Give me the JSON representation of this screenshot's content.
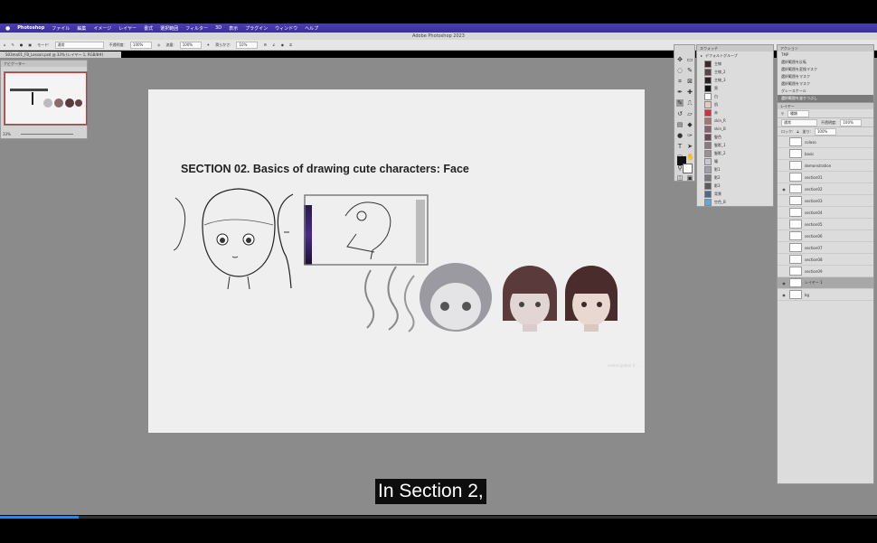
{
  "menubar": {
    "app": "Photoshop",
    "items": [
      "ファイル",
      "編集",
      "イメージ",
      "レイヤー",
      "書式",
      "選択範囲",
      "フィルター",
      "3D",
      "表示",
      "プラグイン",
      "ウィンドウ",
      "ヘルプ"
    ]
  },
  "window": {
    "title": "Adobe Photoshop 2023",
    "document_tab": "S03ma01_FB_Lesson.psd @ 33% (レイヤー 1, RGB/8#)"
  },
  "options_bar": {
    "mode_label": "モード:",
    "mode_value": "通常",
    "opacity_label": "不透明度:",
    "opacity_value": "100%",
    "flow_label": "流量:",
    "flow_value": "100%",
    "smoothing_label": "滑らかさ:",
    "smoothing_value": "10%"
  },
  "navigator": {
    "title": "ナビゲーター",
    "zoom": "33%"
  },
  "canvas": {
    "heading": "SECTION 02.  Basics of drawing cute characters: Face",
    "watermark": "coloso.global © ..."
  },
  "swatches": {
    "title": "スウォッチ",
    "group": "デフォルトグループ",
    "items": [
      {
        "name": "主線",
        "color": "#3a2a28"
      },
      {
        "name": "主線_2",
        "color": "#5a4642"
      },
      {
        "name": "主線_3",
        "color": "#2a2222"
      },
      {
        "name": "黒",
        "color": "#111111"
      },
      {
        "name": "白",
        "color": "#ffffff"
      },
      {
        "name": "肌",
        "color": "#e8c9b8"
      },
      {
        "name": "赤",
        "color": "#d03040"
      },
      {
        "name": "skin_R",
        "color": "#b07070"
      },
      {
        "name": "skin_B",
        "color": "#8a6070"
      },
      {
        "name": "髪色",
        "color": "#6a4a50"
      },
      {
        "name": "髪影_1",
        "color": "#8a7a80"
      },
      {
        "name": "髪影_2",
        "color": "#9a9098"
      },
      {
        "name": "瞳",
        "color": "#c8c8d0"
      },
      {
        "name": "影1",
        "color": "#a0a0a8"
      },
      {
        "name": "影2",
        "color": "#7a7a80"
      },
      {
        "name": "影3",
        "color": "#5a5a60"
      },
      {
        "name": "背景",
        "color": "#4a6a90"
      },
      {
        "name": "空色_B",
        "color": "#60a8d8"
      }
    ]
  },
  "actions": {
    "title": "アクション",
    "items": [
      "TMP",
      "選択範囲を反転",
      "選択範囲を変換マスク",
      "選択範囲をマスク",
      "選択範囲をマスク",
      "グレースケール",
      "選択範囲を塗りつぶし"
    ]
  },
  "layers": {
    "title": "レイヤー",
    "filter": "種類",
    "blend": "通常",
    "opacity_label": "不透明度:",
    "opacity": "100%",
    "lock_label": "ロック:",
    "fill_label": "塗り:",
    "fill": "100%",
    "items": [
      {
        "name": "coloso",
        "visible": false,
        "selected": false
      },
      {
        "name": "basic",
        "visible": false,
        "selected": false
      },
      {
        "name": "demonstration",
        "visible": false,
        "selected": false
      },
      {
        "name": "section01",
        "visible": false,
        "selected": false
      },
      {
        "name": "section02",
        "visible": true,
        "selected": false
      },
      {
        "name": "section03",
        "visible": false,
        "selected": false
      },
      {
        "name": "section04",
        "visible": false,
        "selected": false
      },
      {
        "name": "section05",
        "visible": false,
        "selected": false
      },
      {
        "name": "section06",
        "visible": false,
        "selected": false
      },
      {
        "name": "section07",
        "visible": false,
        "selected": false
      },
      {
        "name": "section08",
        "visible": false,
        "selected": false
      },
      {
        "name": "section09",
        "visible": false,
        "selected": false
      },
      {
        "name": "レイヤー 1",
        "visible": true,
        "selected": true
      },
      {
        "name": "bg",
        "visible": true,
        "selected": false
      }
    ]
  },
  "subtitle": "In Section 2,",
  "player": {
    "progress": 0.09
  }
}
